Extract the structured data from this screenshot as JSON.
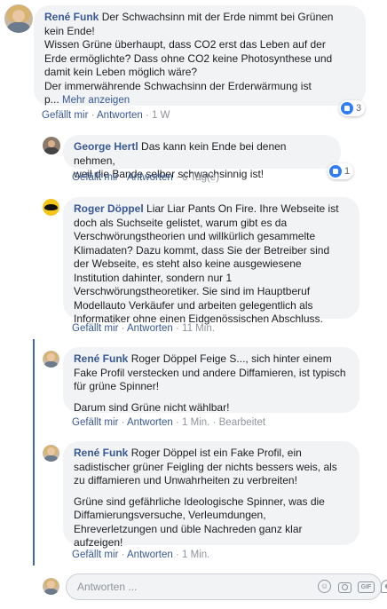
{
  "comments": [
    {
      "author": "René Funk",
      "text_lines": [
        "Der Schwachsinn mit der Erde nimmt bei Grünen",
        "kein Ende!",
        "Wissen Grüne überhaupt, dass CO2 erst das Leben auf der",
        "Erde ermöglichte? Dass ohne CO2 keine Photosynthese und",
        "damit kein Leben möglich wäre?",
        "Der immerwährende Schwachsinn der Erderwärmung ist",
        "p..."
      ],
      "more_label": "Mehr anzeigen",
      "like_label": "Gefällt mir",
      "reply_label": "Antworten",
      "time": "1 W",
      "reaction_count": "3"
    },
    {
      "author": "George Hertl",
      "text_lines": [
        "Das kann kein Ende bei denen nehmen,",
        "weil die Bande selber schwachsinnig ist!"
      ],
      "like_label": "Gefällt mir",
      "reply_label": "Antworten",
      "time": "6 Tag(e)",
      "reaction_count": "1"
    },
    {
      "author": "Roger Döppel",
      "text_lines": [
        "Liar Liar Pants On Fire. Ihre Webseite ist",
        "doch als Suchseite gelistet, warum gibt es da",
        "Verschwörungstheorien und willkürlich gesammelte",
        "Klimadaten? Dazu kommt, dass Sie der Betreiber sind",
        "der Webseite, es steht also keine ausgewiesene",
        "Institution dahinter, sondern nur 1",
        "Verschwörungstheoretiker. Sie sind im Hauptberuf",
        "Modellauto Verkäufer und arbeiten gelegentlich als",
        "Informatiker ohne einen Eidgenössischen Abschluss."
      ],
      "like_label": "Gefällt mir",
      "reply_label": "Antworten",
      "time": "11 Min."
    },
    {
      "author": "René Funk",
      "text_lines": [
        "Roger Döppel Feige S..., sich hinter einem",
        "Fake Profil verstecken und andere Diffamieren, ist typisch",
        "für grüne Spinner!",
        "",
        "Darum sind Grüne nicht wählbar!"
      ],
      "like_label": "Gefällt mir",
      "reply_label": "Antworten",
      "time": "1 Min.",
      "edited_label": "Bearbeitet"
    },
    {
      "author": "René Funk",
      "text_lines": [
        "Roger Döppel ist ein Fake Profil, ein",
        "sadistischer grüner Feigling der nichts bessers weis, als",
        "zu diffamieren und Unwahrheiten zu verbreiten!",
        "",
        "Grüne sind gefährliche Ideologische Spinner, was die",
        "Diffamierungsversuche, Verleumdungen,",
        "Ehreverletzungen und üble Nachreden ganz klar",
        "aufzeigen!"
      ],
      "like_label": "Gefällt mir",
      "reply_label": "Antworten",
      "time": "1 Min."
    }
  ],
  "reply_box": {
    "placeholder": "Antworten ...",
    "icons": [
      "emoji-icon",
      "camera-icon",
      "gif-icon",
      "sticker-icon"
    ]
  },
  "colors": {
    "link": "#385898",
    "bubble": "#f2f3f5",
    "thread_line": "#4267b2",
    "reaction": "#2e7cf6"
  }
}
